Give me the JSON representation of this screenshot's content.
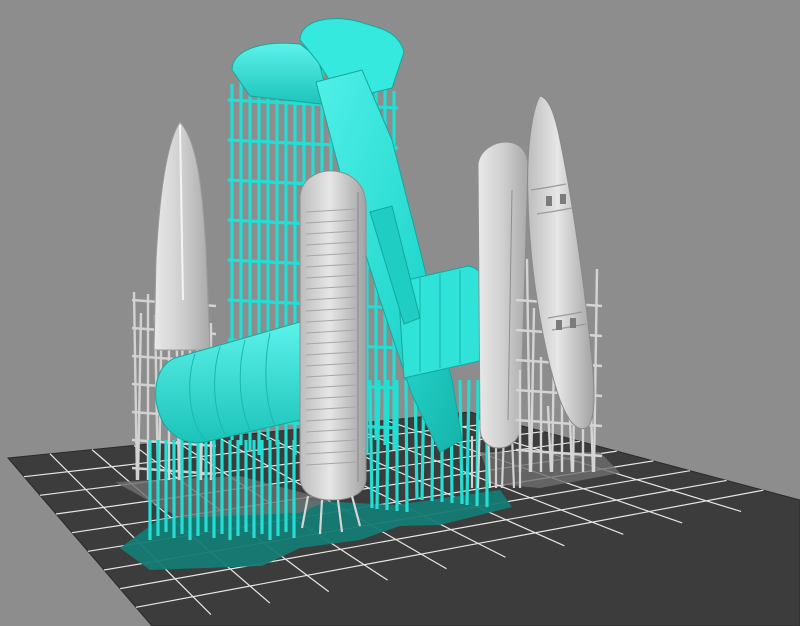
{
  "viewport": {
    "background_color": "#8d8d8d",
    "build_plate_color": "#3c3c3c",
    "grid_line_color": "#e6e6e6",
    "raft_color": "#157a74"
  },
  "models": {
    "selected_color": "#27e2d8",
    "unselected_color": "#c9c9c9",
    "items": [
      {
        "name": "nose-cone-left",
        "selected": false
      },
      {
        "name": "wing-and-tail-assembly",
        "selected": true
      },
      {
        "name": "upright-wing-panel",
        "selected": false
      },
      {
        "name": "upright-panel-right",
        "selected": false
      },
      {
        "name": "fuselage-right",
        "selected": false
      }
    ]
  }
}
